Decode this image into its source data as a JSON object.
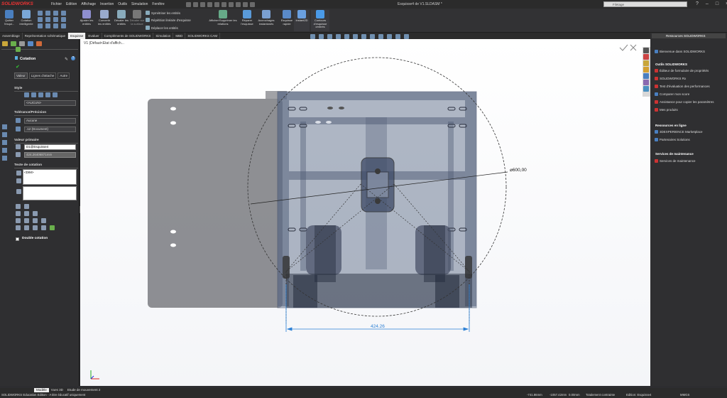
{
  "app": {
    "brand": "SOLIDWORKS",
    "doc_title": "Esquisse4 de V1.SLDASM *"
  },
  "menu": [
    "Fichier",
    "Edition",
    "Affichage",
    "Insertion",
    "Outils",
    "Simulation",
    "Fenêtre"
  ],
  "search_placeholder": "Filetage",
  "ribbon": {
    "quit": "Quitter l'esqui...",
    "smart_dim": "Cotation intelligente",
    "trim": "Ajuster les entités",
    "convert": "Convertir les entités",
    "offset": "Décaler les entités",
    "offset_surface": "Décaler sur la surface",
    "mirror": "Symétriser les entités",
    "linear_pattern": "Répétition linéaire d'esquisse",
    "move": "Déplacer les entités",
    "relations": "Afficher/Supprimer les relations",
    "repair": "Réparer l'esquisse",
    "quick_snaps": "Accrochages instantanés",
    "rapid_sketch": "Esquisse rapide",
    "instant2d": "Instant2D",
    "shaded_contours": "Contours d'esquisse ombrés"
  },
  "tabs": [
    "Assemblage",
    "Représentation schématique",
    "Esquisse",
    "Evaluer",
    "Compléments de SOLIDWORKS",
    "Simulation",
    "MBD",
    "SOLIDWORKS CAM"
  ],
  "active_tab": "Esquisse",
  "property_manager": {
    "title": "Cotation",
    "subtabs": [
      "Valeur",
      "Lignes d'attache",
      "Autre"
    ],
    "style_label": "Style",
    "style_value": "<AUCUN>",
    "tolerance_label": "Tolérance/Précision",
    "tolerance_value": "Aucune",
    "precision_value": ".12 (Document)",
    "primary_label": "Valeur primaire",
    "primary_name": "D1@Esquisse4",
    "primary_value": "424.26406871mm",
    "text_label": "Texte de cotation",
    "text_value": "<DIM>",
    "double_dim": "Double cotation"
  },
  "viewport": {
    "tree_label": "V1 (Défaut<Etat d'affich...",
    "dim_diameter": "⌀600,00",
    "dim_linear": "424.26"
  },
  "task_pane": {
    "title": "Ressources SOLIDWORKS",
    "welcome": "Bienvenue dans SOLIDWORKS",
    "tools_heading": "Outils SOLIDWORKS",
    "tools": [
      "Éditeur de formulaire de propriétés",
      "SOLIDWORKS Rx",
      "Test d'évaluation des performances",
      "Comparer mon score",
      "Assistance pour copier les paramètres",
      "Mes produits"
    ],
    "online_heading": "Ressources en ligne",
    "online": [
      "3DEXPERIENCE Marketplace",
      "Partenaires Solutions"
    ],
    "maint_heading": "Services de maintenance",
    "maint": [
      "Services de maintenance"
    ]
  },
  "bottom_tabs": [
    "Modèle",
    "Vues 3D",
    "Etude de mouvement 2"
  ],
  "active_bottom_tab": "Modèle",
  "status": {
    "edition": "SOLIDWORKS Education Edition - A titre éducatif uniquement",
    "x": "-741.86mm",
    "y": "-1057.42mm",
    "z": "0.00mm",
    "constraint": "Totalement contrainte",
    "editing": "Edition: Esquisse4",
    "units": "MMGS"
  },
  "colors": {
    "brand_red": "#e03030",
    "dim_blue": "#2a7fd4",
    "panel_dark": "#2f2f31"
  }
}
